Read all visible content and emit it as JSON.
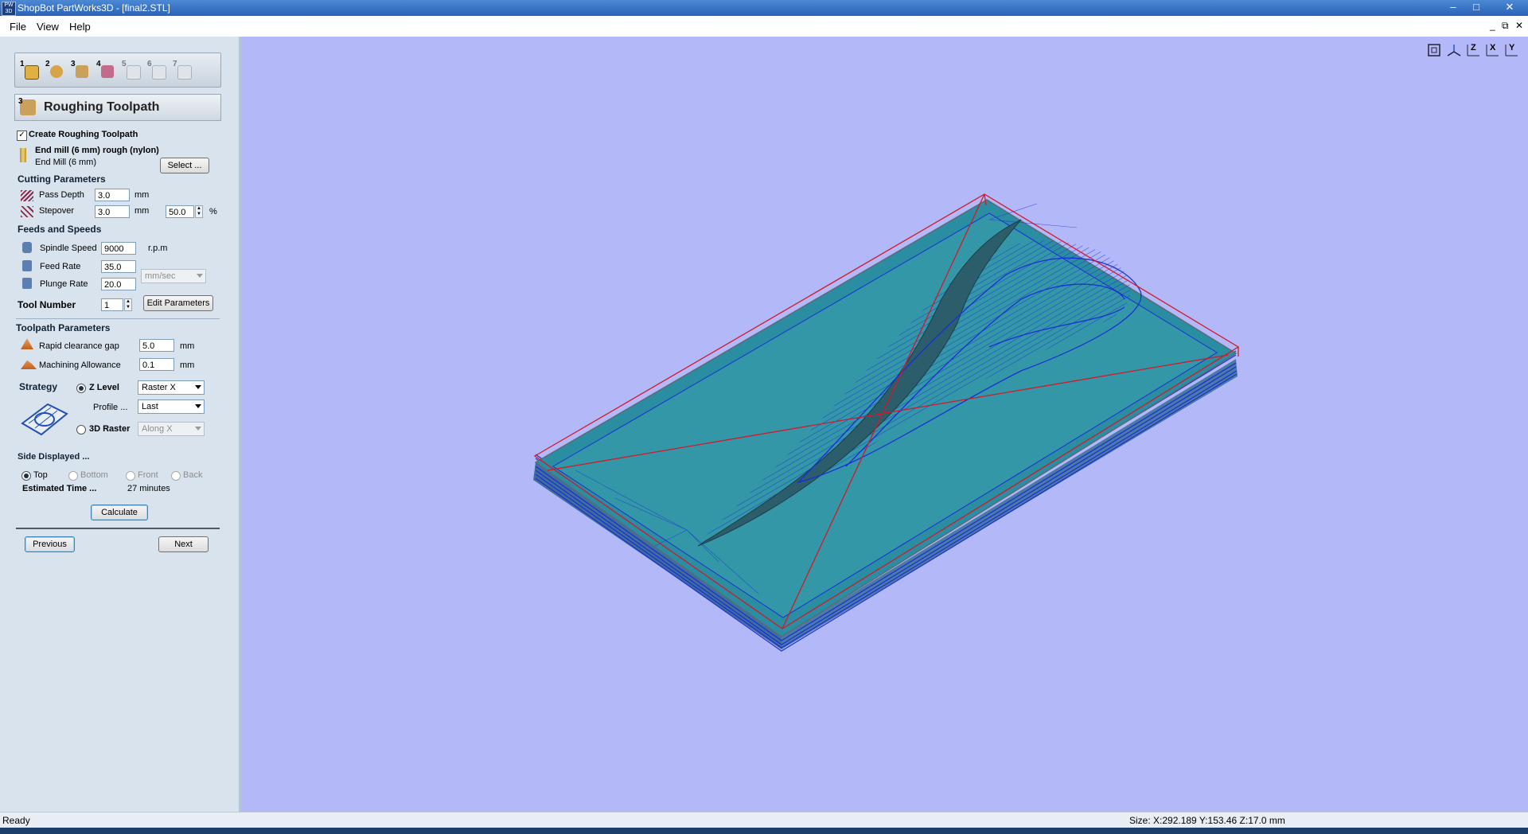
{
  "window": {
    "app_icon_text": "PW 3D",
    "title": "ShopBot PartWorks3D - [final2.STL]",
    "controls": [
      "minimize-icon",
      "maximize-icon",
      "close-icon"
    ]
  },
  "menu": {
    "items": [
      "File",
      "View",
      "Help"
    ]
  },
  "steps": {
    "numbers": [
      "1",
      "2",
      "3",
      "4",
      "5",
      "6",
      "7"
    ]
  },
  "panel": {
    "title": "Roughing Toolpath",
    "title_step": "3",
    "create_label": "Create Roughing Toolpath",
    "create_checked": true,
    "tool_name": "End mill (6 mm) rough (nylon)",
    "tool_type": "End Mill (6 mm)",
    "select_button": "Select ...",
    "cutting": {
      "header": "Cutting Parameters",
      "pass_depth_label": "Pass Depth",
      "pass_depth": "3.0",
      "pass_depth_unit": "mm",
      "stepover_label": "Stepover",
      "stepover": "3.0",
      "stepover_unit": "mm",
      "stepover_pct": "50.0",
      "pct_unit": "%"
    },
    "feeds": {
      "header": "Feeds and Speeds",
      "spindle_label": "Spindle Speed",
      "spindle": "9000",
      "spindle_unit": "r.p.m",
      "feed_label": "Feed Rate",
      "feed": "35.0",
      "plunge_label": "Plunge Rate",
      "plunge": "20.0",
      "rate_unit": "mm/sec",
      "tool_number_label": "Tool Number",
      "tool_number": "1",
      "edit_button": "Edit Parameters"
    },
    "toolpath": {
      "header": "Toolpath Parameters",
      "rapid_label": "Rapid clearance gap",
      "rapid": "5.0",
      "rapid_unit": "mm",
      "allowance_label": "Machining Allowance",
      "allowance": "0.1",
      "allowance_unit": "mm"
    },
    "strategy": {
      "header": "Strategy",
      "zlevel_label": "Z Level",
      "zlevel_selected": true,
      "zlevel_option": "Raster X",
      "profile_label": "Profile ...",
      "profile_option": "Last",
      "raster3d_label": "3D Raster",
      "raster3d_option": "Along X"
    },
    "side": {
      "header": "Side Displayed ...",
      "options": [
        "Top",
        "Bottom",
        "Front",
        "Back"
      ],
      "selected": "Top",
      "estimated_label": "Estimated Time ...",
      "estimated_value": "27 minutes"
    },
    "calculate_button": "Calculate",
    "previous_button": "Previous",
    "next_button": "Next"
  },
  "viewport": {
    "background": "#b3b8f8",
    "view_icons": [
      "fit-view-icon",
      "iso-view-icon",
      "z-view-icon",
      "x-view-icon",
      "y-view-icon"
    ],
    "view_icon_letters": [
      "",
      "",
      "Z",
      "X",
      "Y"
    ]
  },
  "status": {
    "left": "Ready",
    "right": "Size: X:292.189 Y:153.46 Z:17.0 mm"
  }
}
